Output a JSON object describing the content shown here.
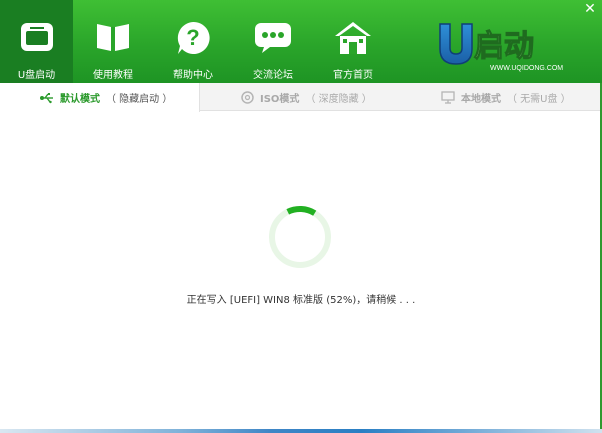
{
  "window": {
    "close_glyph": "✕"
  },
  "nav": {
    "items": [
      {
        "label": "U盘启动",
        "icon": "window-icon",
        "active": true
      },
      {
        "label": "使用教程",
        "icon": "book-icon",
        "active": false
      },
      {
        "label": "帮助中心",
        "icon": "question-icon",
        "active": false
      },
      {
        "label": "交流论坛",
        "icon": "chat-icon",
        "active": false
      },
      {
        "label": "官方首页",
        "icon": "home-icon",
        "active": false
      }
    ]
  },
  "logo": {
    "text": "启动",
    "url_text": "WWW.UQIDONG.COM",
    "letter": "U"
  },
  "tabs": [
    {
      "main": "默认模式",
      "sub": "（ 隐藏启动 ）",
      "icon": "usb-icon",
      "active": true
    },
    {
      "main": "ISO模式",
      "sub": "（ 深度隐藏 ）",
      "icon": "disc-icon",
      "active": false
    },
    {
      "main": "本地模式",
      "sub": "（ 无需U盘 ）",
      "icon": "monitor-icon",
      "active": false
    }
  ],
  "progress": {
    "status_text": "正在写入 [UEFI] WIN8 标准版 (52%)，请稍候 . . .",
    "percent": 52,
    "spinner_arc_fraction": 0.16
  },
  "colors": {
    "brand_green": "#2aa52a",
    "active_green": "#1a7e22",
    "spinner_green": "#22b022",
    "spinner_track": "#e8f6e6"
  }
}
